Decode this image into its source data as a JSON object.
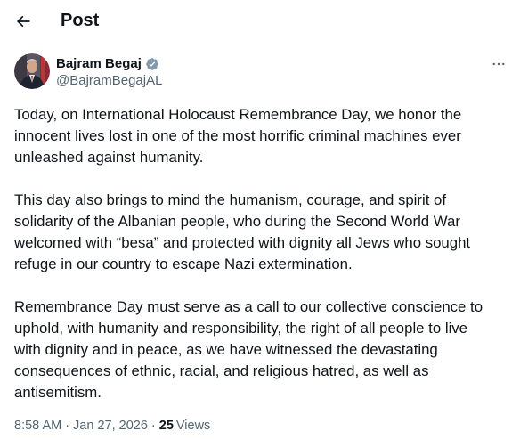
{
  "header": {
    "back_icon": "arrow-left-icon",
    "title": "Post"
  },
  "author": {
    "display_name": "Bajram Begaj",
    "handle": "@BajramBegajAL",
    "verified_icon": "verified-badge-icon",
    "verified_color": "#829aab"
  },
  "more_icon": "more-horizontal-icon",
  "post": {
    "paragraphs": [
      "Today, on International Holocaust Remembrance Day, we honor the\ninnocent lives lost in one of the most horrific criminal machines ever\nunleashed against humanity.",
      "This day also brings to mind the humanism, courage, and spirit of\nsolidarity of the Albanian people, who during the Second World War\nwelcomed with “besa” and protected with dignity all Jews who sought\nrefuge in our country to escape Nazi extermination.",
      "Remembrance Day must serve as a call to our collective conscience to\nuphold, with humanity and responsibility, the right of all people to live\nwith dignity and in peace, as we have witnessed the devastating\nconsequences of ethnic, racial, and religious hatred, as well as\nantisemitism."
    ]
  },
  "meta": {
    "time": "8:58 AM",
    "separator": "·",
    "date": "Jan 27, 2026",
    "views_count": "25",
    "views_label": "Views"
  },
  "colors": {
    "text_primary": "#0f1419",
    "text_secondary": "#536471"
  }
}
